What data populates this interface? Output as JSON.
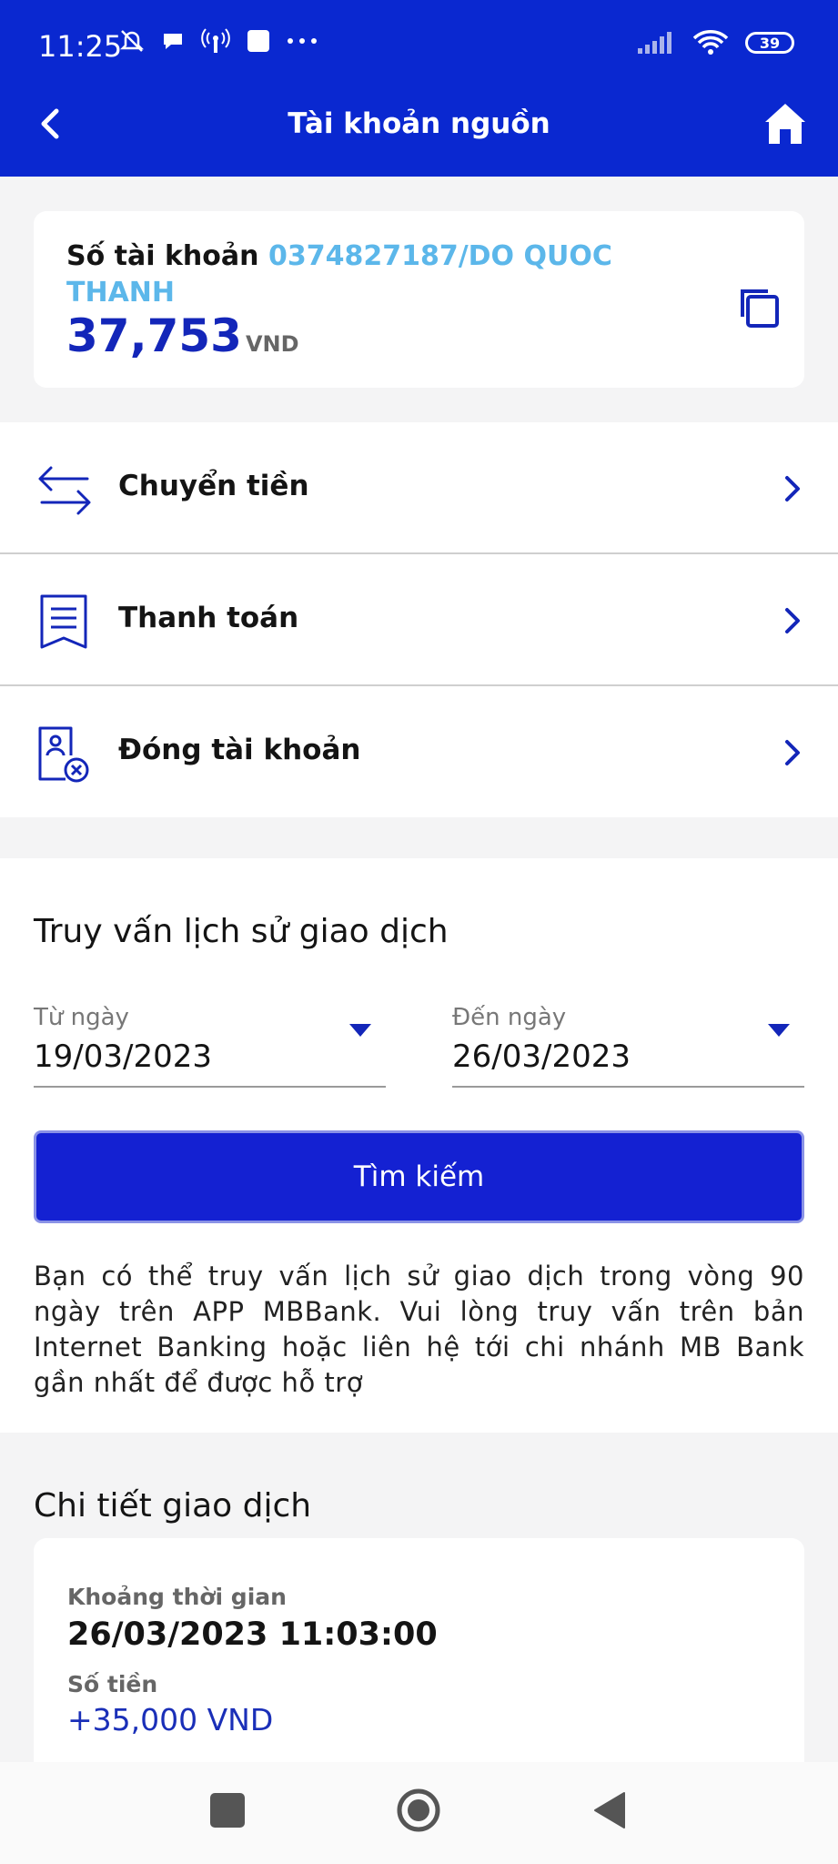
{
  "status_bar": {
    "time": "11:25",
    "battery": "39",
    "icons_left": [
      "bell-off-icon",
      "chat-bubble-icon",
      "hotspot-icon",
      "square-app-icon",
      "more-dots-icon"
    ],
    "icons_right": [
      "signal-icon",
      "wifi-icon",
      "battery-icon"
    ]
  },
  "header": {
    "title": "Tài khoản nguồn",
    "background": "#0a28d0"
  },
  "account": {
    "label": "Số tài khoản",
    "number": "0374827187/DO QUOC THANH",
    "balance": "37,753",
    "currency": "VND"
  },
  "menu": {
    "items": [
      {
        "label": "Chuyển tiền",
        "icon": "transfer-arrows-icon"
      },
      {
        "label": "Thanh toán",
        "icon": "receipt-icon"
      },
      {
        "label": "Đóng tài khoản",
        "icon": "close-account-icon"
      }
    ]
  },
  "history": {
    "title": "Truy vấn lịch sử giao dịch",
    "from_label": "Từ ngày",
    "from_value": "19/03/2023",
    "to_label": "Đến ngày",
    "to_value": "26/03/2023",
    "search_label": "Tìm kiếm",
    "note": "Bạn có thể truy vấn lịch sử giao dịch trong vòng 90 ngày trên APP MBBank. Vui lòng truy vấn trên bản Internet Banking hoặc liên hệ tới chi nhánh MB Bank gần nhất để được hỗ trợ"
  },
  "details": {
    "title": "Chi tiết giao dịch",
    "time_label": "Khoảng thời gian",
    "time_value": "26/03/2023 11:03:00",
    "amount_label": "Số tiền",
    "amount_value": "+35,000 VND"
  },
  "colors": {
    "brand": "#0a28d0",
    "button": "#1421d2",
    "account_number": "#5cb7ea",
    "balance": "#1326b9"
  }
}
